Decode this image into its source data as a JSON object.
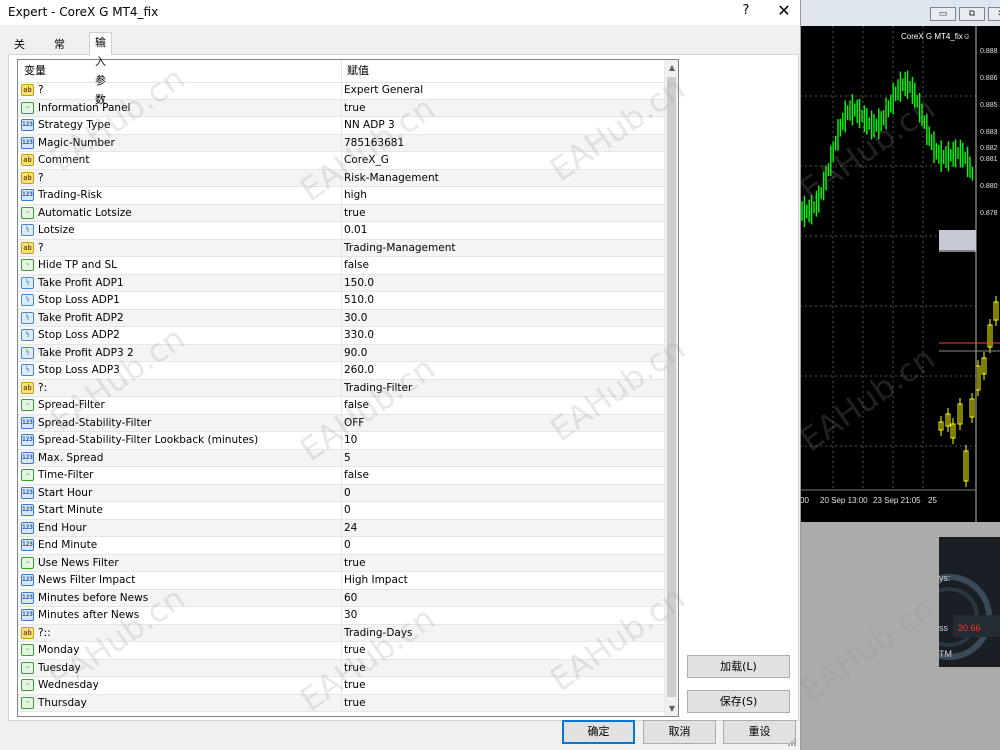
{
  "dialog": {
    "title": "Expert - CoreX G MT4_fix",
    "help_label": "?",
    "close_label": "✕"
  },
  "tabs": [
    {
      "label": "关于",
      "active": false
    },
    {
      "label": "常用",
      "active": false
    },
    {
      "label": "输入参数",
      "active": true
    }
  ],
  "grid": {
    "col_variable": "变量",
    "col_value": "赋值",
    "rows": [
      {
        "type": "ab",
        "name": "?",
        "value": "Expert General"
      },
      {
        "type": "bool",
        "name": "Information Panel",
        "value": "true"
      },
      {
        "type": "int",
        "name": "Strategy Type",
        "value": "NN ADP 3"
      },
      {
        "type": "int",
        "name": "Magic-Number",
        "value": "785163681"
      },
      {
        "type": "ab",
        "name": "Comment",
        "value": "CoreX_G"
      },
      {
        "type": "ab",
        "name": "?",
        "value": "Risk-Management"
      },
      {
        "type": "int",
        "name": "Trading-Risk",
        "value": "high"
      },
      {
        "type": "bool",
        "name": "Automatic Lotsize",
        "value": "true"
      },
      {
        "type": "dbl",
        "name": "Lotsize",
        "value": "0.01"
      },
      {
        "type": "ab",
        "name": "?",
        "value": "Trading-Management"
      },
      {
        "type": "bool",
        "name": "Hide TP and SL",
        "value": "false"
      },
      {
        "type": "dbl",
        "name": "Take Profit ADP1",
        "value": "150.0"
      },
      {
        "type": "dbl",
        "name": "Stop Loss ADP1",
        "value": "510.0"
      },
      {
        "type": "dbl",
        "name": "Take Profit ADP2",
        "value": "30.0"
      },
      {
        "type": "dbl",
        "name": "Stop Loss ADP2",
        "value": "330.0"
      },
      {
        "type": "dbl",
        "name": "Take Profit ADP3 2",
        "value": "90.0"
      },
      {
        "type": "dbl",
        "name": "Stop Loss ADP3",
        "value": "260.0"
      },
      {
        "type": "ab",
        "name": "?:",
        "value": "Trading-Filter"
      },
      {
        "type": "bool",
        "name": "Spread-Filter",
        "value": "false"
      },
      {
        "type": "int",
        "name": "Spread-Stability-Filter",
        "value": "OFF"
      },
      {
        "type": "int",
        "name": "Spread-Stability-Filter Lookback (minutes)",
        "value": "10"
      },
      {
        "type": "int",
        "name": "Max. Spread",
        "value": "5"
      },
      {
        "type": "bool",
        "name": "Time-Filter",
        "value": "false"
      },
      {
        "type": "int",
        "name": "Start Hour",
        "value": "0"
      },
      {
        "type": "int",
        "name": "Start Minute",
        "value": "0"
      },
      {
        "type": "int",
        "name": "End Hour",
        "value": "24"
      },
      {
        "type": "int",
        "name": "End Minute",
        "value": "0"
      },
      {
        "type": "bool",
        "name": "Use News Filter",
        "value": "true"
      },
      {
        "type": "int",
        "name": "News Filter Impact",
        "value": "High Impact"
      },
      {
        "type": "int",
        "name": "Minutes before News",
        "value": "60"
      },
      {
        "type": "int",
        "name": "Minutes after News",
        "value": "30"
      },
      {
        "type": "ab",
        "name": "?::",
        "value": "Trading-Days"
      },
      {
        "type": "bool",
        "name": "Monday",
        "value": "true"
      },
      {
        "type": "bool",
        "name": "Tuesday",
        "value": "true"
      },
      {
        "type": "bool",
        "name": "Wednesday",
        "value": "true"
      },
      {
        "type": "bool",
        "name": "Thursday",
        "value": "true"
      }
    ]
  },
  "icon_glyphs": {
    "ab": "ab",
    "int": "123",
    "dbl": "½",
    "bool": "~"
  },
  "buttons": {
    "load": "加载(L)",
    "save": "保存(S)",
    "ok": "确定",
    "cancel": "取消",
    "reset": "重设"
  },
  "background_chart": {
    "title": "CoreX G MT4_fix☺",
    "price_labels": [
      "0.888",
      "0.886",
      "0.885",
      "0.883",
      "0.882",
      "0.881",
      "0.880",
      "0.878"
    ],
    "time_labels": [
      "00",
      "20 Sep 13:00",
      "23 Sep 21:05",
      "25"
    ],
    "panel_texts": [
      "ys:",
      "ss",
      "20.66",
      "TM"
    ]
  },
  "watermark_text": "EAHub.cn",
  "colors": {
    "grid_border": "#828790",
    "candle_green": "#00ff00",
    "candle_yellow": "#ffff00",
    "primary_button_border": "#0078d7"
  }
}
